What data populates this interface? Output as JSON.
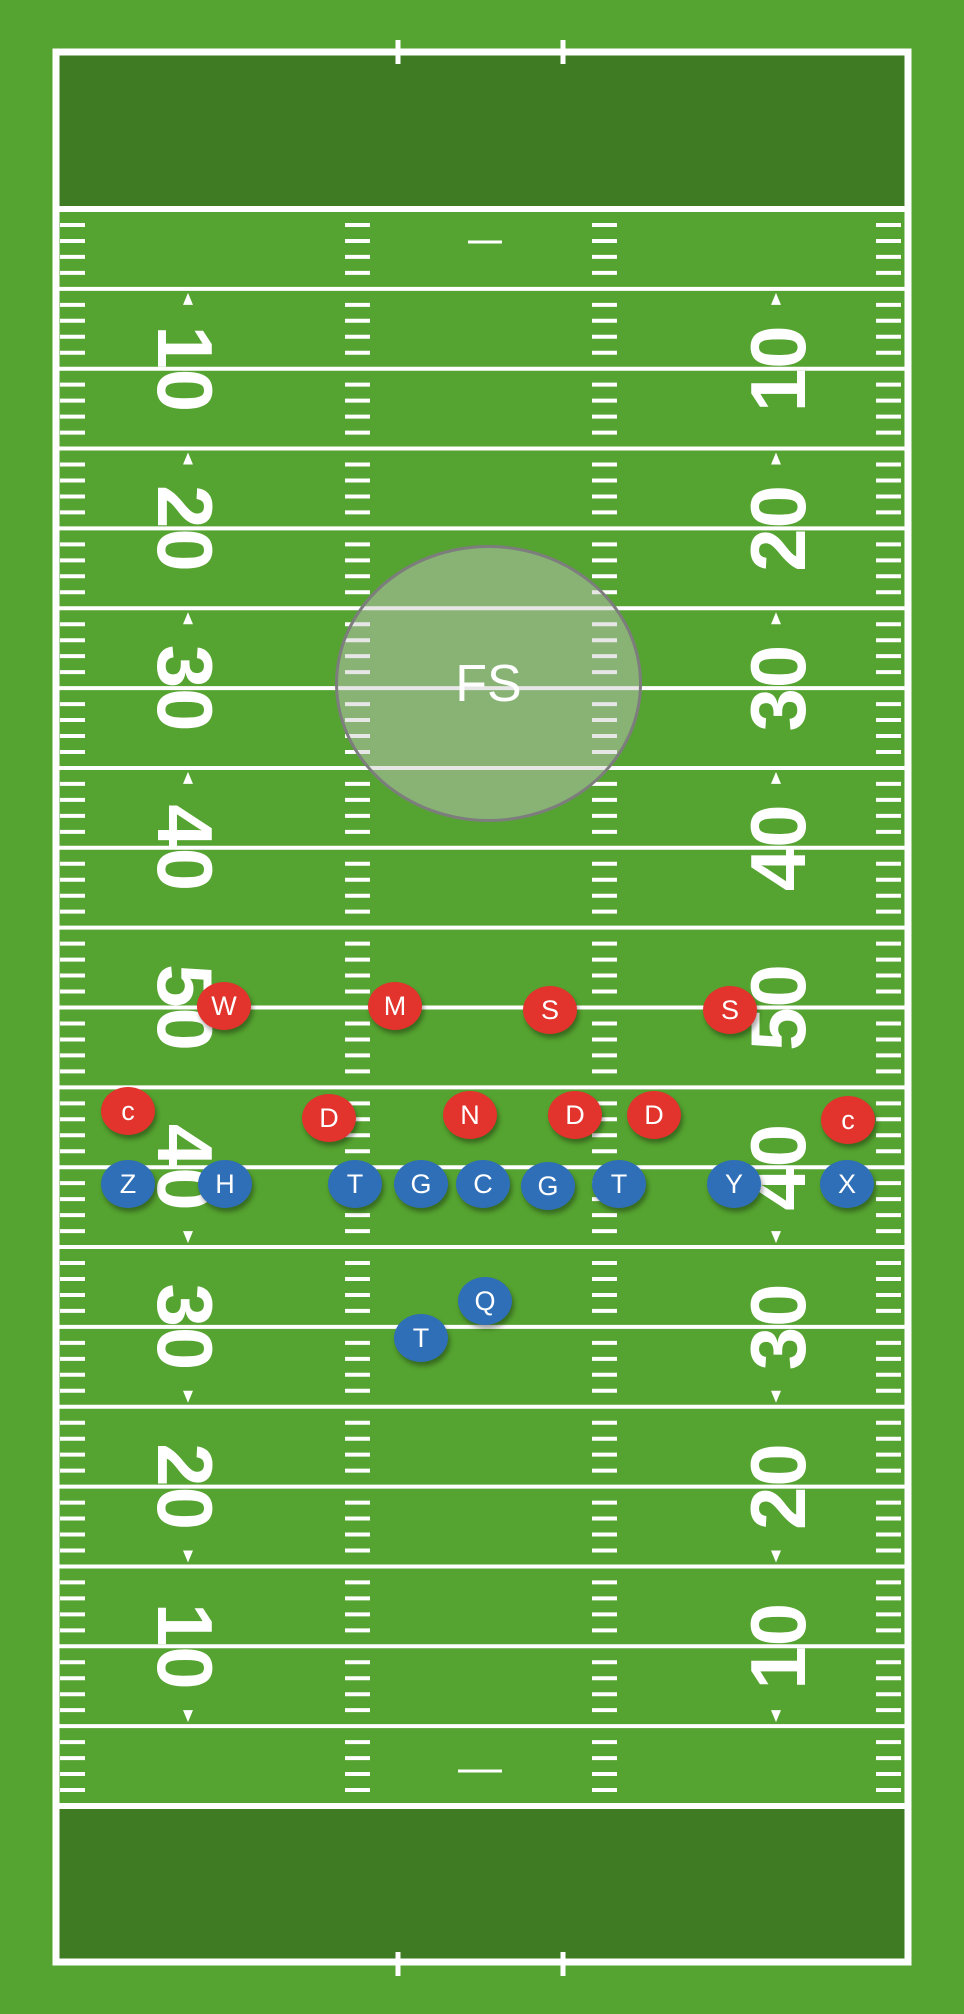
{
  "colors": {
    "grass": "#55a330",
    "endzone": "#3e7b22",
    "lines": "#ffffff",
    "defense": "#e2332d",
    "offense": "#2f6fb8",
    "safety_zone": "#c8c8c8"
  },
  "yard_numbers": [
    "10",
    "20",
    "30",
    "40",
    "50",
    "40",
    "30",
    "20",
    "10"
  ],
  "safety_zone": {
    "label": "FS"
  },
  "defense": [
    {
      "label": "W"
    },
    {
      "label": "M"
    },
    {
      "label": "S"
    },
    {
      "label": "S"
    },
    {
      "label": "c"
    },
    {
      "label": "D"
    },
    {
      "label": "N"
    },
    {
      "label": "D"
    },
    {
      "label": "D"
    },
    {
      "label": "c"
    }
  ],
  "offense": [
    {
      "label": "Z"
    },
    {
      "label": "H"
    },
    {
      "label": "T"
    },
    {
      "label": "G"
    },
    {
      "label": "C"
    },
    {
      "label": "G"
    },
    {
      "label": "T"
    },
    {
      "label": "Y"
    },
    {
      "label": "X"
    },
    {
      "label": "Q"
    },
    {
      "label": "T"
    }
  ]
}
